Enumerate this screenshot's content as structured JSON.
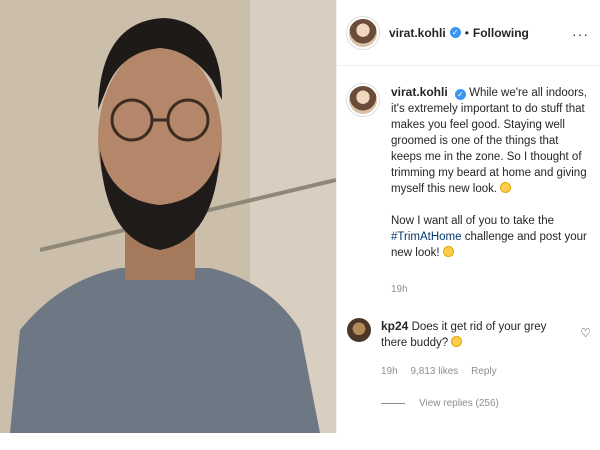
{
  "post": {
    "username": "virat.kohli",
    "verified_mark": "✓",
    "separator": "•",
    "follow_status": "Following",
    "more_options": "···"
  },
  "caption": {
    "username": "virat.kohli",
    "paragraph1": "While we're all indoors, it's extremely important to do stuff that makes you feel good. Staying well groomed is one of the things that keeps me in the zone. So I thought of trimming my beard at home and giving myself this new look.",
    "paragraph2_before": "Now I want all of you to take the ",
    "hashtag": "#TrimAtHome",
    "paragraph2_after": " challenge and post your new look!",
    "time": "19h"
  },
  "comment": {
    "username": "kp24",
    "text": "Does it get rid of your grey there buddy?",
    "time": "19h",
    "likes": "9,813 likes",
    "reply_label": "Reply",
    "view_replies": "View replies (256)"
  },
  "icons": {
    "heart": "♡"
  },
  "colors": {
    "verified_blue": "#3897f0",
    "hashtag": "#00376b",
    "muted": "#8e8e8e"
  }
}
